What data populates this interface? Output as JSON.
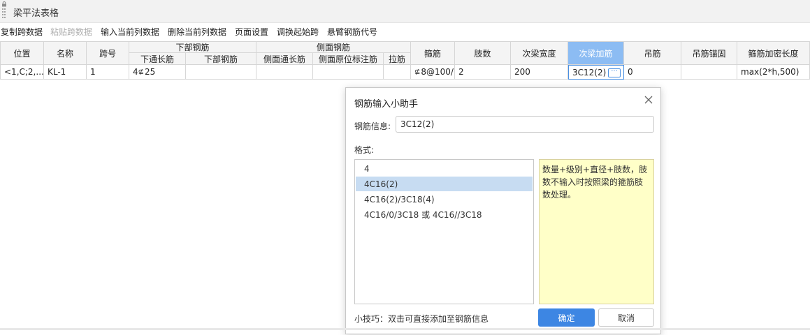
{
  "window": {
    "title": "梁平法表格"
  },
  "toolbar": {
    "items": [
      {
        "label": "复制跨数据",
        "disabled": false
      },
      {
        "label": "粘贴跨数据",
        "disabled": true
      },
      {
        "label": "输入当前列数据",
        "disabled": false
      },
      {
        "label": "删除当前列数据",
        "disabled": false
      },
      {
        "label": "页面设置",
        "disabled": false
      },
      {
        "label": "调换起始跨",
        "disabled": false
      },
      {
        "label": "悬臂钢筋代号",
        "disabled": false
      }
    ]
  },
  "table": {
    "group_headers": {
      "bottom_rebar": "下部钢筋",
      "side_rebar": "侧面钢筋"
    },
    "headers": {
      "position": "位置",
      "name": "名称",
      "span": "跨号",
      "bottom_through": "下通长筋",
      "bottom_rebar": "下部钢筋",
      "side_through": "侧面通长筋",
      "side_original": "侧面原位标注筋",
      "tie_bar": "拉筋",
      "stirrup": "箍筋",
      "legs": "肢数",
      "secondary_width": "次梁宽度",
      "secondary_add": "次梁加筋",
      "hanger": "吊筋",
      "hanger_anchor": "吊筋锚固",
      "stirrup_dense_len": "箍筋加密长度"
    },
    "row": {
      "position": "<1,C;2,...",
      "name": "KL-1",
      "span": "1",
      "bottom_through_symbol": "⊈",
      "bottom_through": "4",
      "bottom_through_dia": "25",
      "stirrup_symbol": "⊈",
      "stirrup": "8@100/",
      "legs": "2",
      "secondary_width": "200",
      "secondary_add": "3C12(2)",
      "hanger": "0",
      "stirrup_dense_len": "max(2*h,500)",
      "ellipsis": "···"
    }
  },
  "dialog": {
    "title": "钢筋输入小助手",
    "info_label": "钢筋信息:",
    "info_value": "3C12(2)",
    "format_label": "格式:",
    "formats": [
      "4",
      "4C16(2)",
      "4C16(2)/3C18(4)",
      "4C16/0/3C18 或 4C16//3C18"
    ],
    "selected_format_index": 1,
    "hint": "数量+级别+直径+肢数，肢数不输入时按照梁的箍筋肢数处理。",
    "tip": "小技巧：双击可直接添加至钢筋信息",
    "ok_label": "确定",
    "cancel_label": "取消"
  },
  "colors": {
    "accent": "#3d86e3",
    "active_header": "#8cbcf3",
    "hint_bg": "#ffffc8",
    "selected_item": "#c7dcf2"
  }
}
